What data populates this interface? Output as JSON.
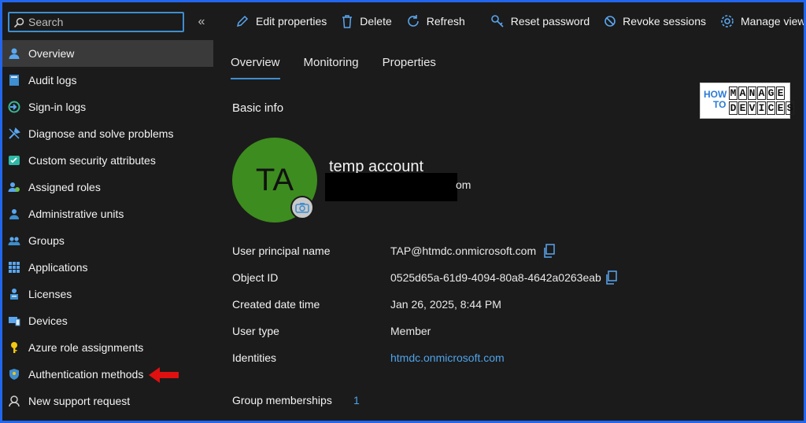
{
  "search": {
    "placeholder": "Search"
  },
  "sidebar": {
    "items": [
      {
        "label": "Overview"
      },
      {
        "label": "Audit logs"
      },
      {
        "label": "Sign-in logs"
      },
      {
        "label": "Diagnose and solve problems"
      },
      {
        "label": "Custom security attributes"
      },
      {
        "label": "Assigned roles"
      },
      {
        "label": "Administrative units"
      },
      {
        "label": "Groups"
      },
      {
        "label": "Applications"
      },
      {
        "label": "Licenses"
      },
      {
        "label": "Devices"
      },
      {
        "label": "Azure role assignments"
      },
      {
        "label": "Authentication methods"
      },
      {
        "label": "New support request"
      }
    ]
  },
  "toolbar": {
    "edit_label": "Edit properties",
    "delete_label": "Delete",
    "refresh_label": "Refresh",
    "reset_label": "Reset password",
    "revoke_label": "Revoke sessions",
    "manage_label": "Manage view"
  },
  "tabs": [
    {
      "label": "Overview"
    },
    {
      "label": "Monitoring"
    },
    {
      "label": "Properties"
    }
  ],
  "basic_info_title": "Basic info",
  "logo": {
    "how": "HOW",
    "to": "TO",
    "manage": "MANAGE",
    "devices": "DEVICES"
  },
  "user": {
    "initials": "TA",
    "display_name": "temp account",
    "email_visible_tail": "om"
  },
  "properties": [
    {
      "label": "User principal name",
      "value": "TAP@htmdc.onmicrosoft.com"
    },
    {
      "label": "Object ID",
      "value": "0525d65a-61d9-4094-80a8-4642a0263eab"
    },
    {
      "label": "Created date time",
      "value": "Jan 26, 2025, 8:44 PM"
    },
    {
      "label": "User type",
      "value": "Member"
    },
    {
      "label": "Identities",
      "value": "htmdc.onmicrosoft.com"
    }
  ],
  "group_memberships": {
    "label": "Group memberships",
    "count": "1"
  },
  "colors": {
    "accent": "#3e8ed0",
    "link": "#4ea3ea",
    "avatar": "#3d8c1f",
    "background": "#1b1b1b",
    "frame": "#2266ee"
  }
}
